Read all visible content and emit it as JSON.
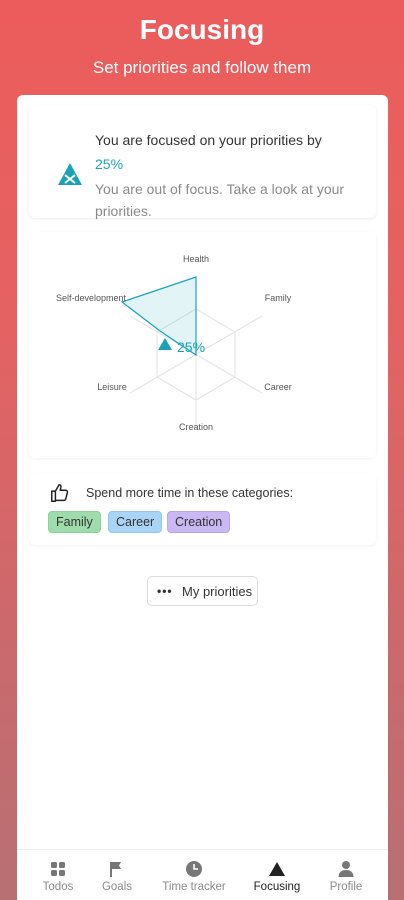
{
  "header": {
    "title": "Focusing",
    "subtitle": "Set priorities and follow them"
  },
  "focus_card": {
    "line1": "You are focused on your priorities by",
    "percent": "25%",
    "line2": "You are out of focus. Take a look at your priorities."
  },
  "radar": {
    "labels": [
      "Health",
      "Family",
      "Career",
      "Creation",
      "Leisure",
      "Self-development"
    ],
    "center_value": "25%",
    "accent": "#1aa3b8"
  },
  "recommendations": {
    "hint": "Spend more time in these categories:",
    "chips": [
      "Family",
      "Career",
      "Creation"
    ]
  },
  "priorities_button": {
    "label": "My priorities"
  },
  "tabbar": {
    "tabs": [
      {
        "label": "Todos",
        "icon": "grid-icon"
      },
      {
        "label": "Goals",
        "icon": "flag-icon"
      },
      {
        "label": "Time tracker",
        "icon": "clock-icon"
      },
      {
        "label": "Focusing",
        "icon": "triangle-icon",
        "active": true
      },
      {
        "label": "Profile",
        "icon": "person-icon"
      }
    ]
  }
}
